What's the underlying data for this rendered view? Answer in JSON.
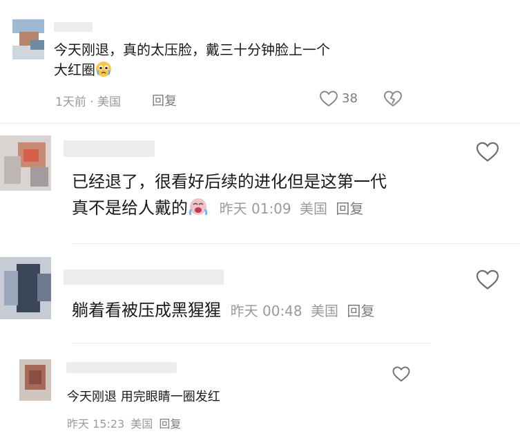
{
  "comments": [
    {
      "text_line1": "今天刚退，真的太压脸，戴三十分钟脸上一个",
      "text_line2": "大红圈",
      "emoji": "crying-face",
      "time": "1天前",
      "dot": "·",
      "location": "美国",
      "reply_label": "回复",
      "likes": "38"
    },
    {
      "text_line1": "已经退了，很看好后续的进化但是这第一代",
      "text_line2": "真不是给人戴的",
      "emoji": "loudly-crying-face",
      "time": "昨天 01:09",
      "location": "美国",
      "reply_label": "回复"
    },
    {
      "text_line1": "躺着看被压成黑猩猩",
      "time": "昨天 00:48",
      "location": "美国",
      "reply_label": "回复"
    },
    {
      "text_line1": "今天刚退 用完眼睛一圈发红",
      "time": "昨天 15:23",
      "location": "美国",
      "reply_label": "回复"
    }
  ]
}
